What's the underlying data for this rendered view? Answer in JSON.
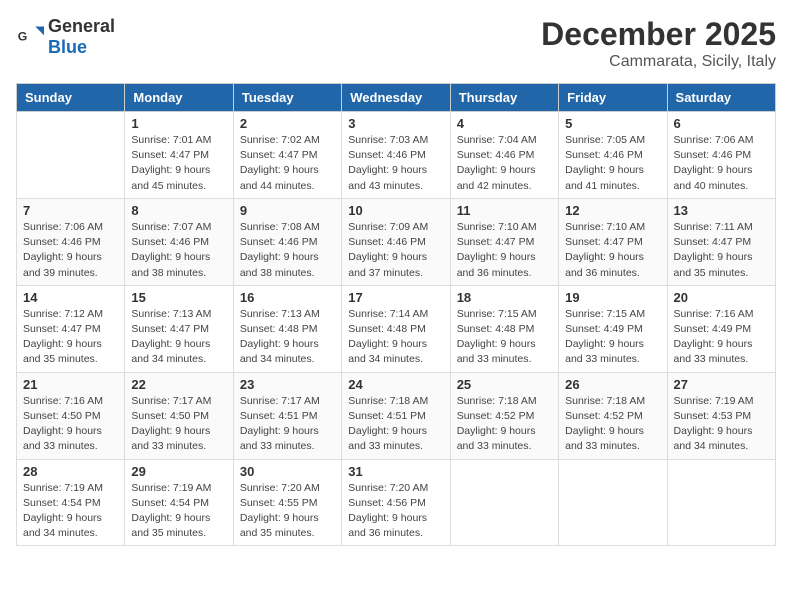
{
  "header": {
    "logo_general": "General",
    "logo_blue": "Blue",
    "month": "December 2025",
    "location": "Cammarata, Sicily, Italy"
  },
  "days_of_week": [
    "Sunday",
    "Monday",
    "Tuesday",
    "Wednesday",
    "Thursday",
    "Friday",
    "Saturday"
  ],
  "weeks": [
    [
      {
        "day": "",
        "sunrise": "",
        "sunset": "",
        "daylight": ""
      },
      {
        "day": "1",
        "sunrise": "Sunrise: 7:01 AM",
        "sunset": "Sunset: 4:47 PM",
        "daylight": "Daylight: 9 hours and 45 minutes."
      },
      {
        "day": "2",
        "sunrise": "Sunrise: 7:02 AM",
        "sunset": "Sunset: 4:47 PM",
        "daylight": "Daylight: 9 hours and 44 minutes."
      },
      {
        "day": "3",
        "sunrise": "Sunrise: 7:03 AM",
        "sunset": "Sunset: 4:46 PM",
        "daylight": "Daylight: 9 hours and 43 minutes."
      },
      {
        "day": "4",
        "sunrise": "Sunrise: 7:04 AM",
        "sunset": "Sunset: 4:46 PM",
        "daylight": "Daylight: 9 hours and 42 minutes."
      },
      {
        "day": "5",
        "sunrise": "Sunrise: 7:05 AM",
        "sunset": "Sunset: 4:46 PM",
        "daylight": "Daylight: 9 hours and 41 minutes."
      },
      {
        "day": "6",
        "sunrise": "Sunrise: 7:06 AM",
        "sunset": "Sunset: 4:46 PM",
        "daylight": "Daylight: 9 hours and 40 minutes."
      }
    ],
    [
      {
        "day": "7",
        "sunrise": "Sunrise: 7:06 AM",
        "sunset": "Sunset: 4:46 PM",
        "daylight": "Daylight: 9 hours and 39 minutes."
      },
      {
        "day": "8",
        "sunrise": "Sunrise: 7:07 AM",
        "sunset": "Sunset: 4:46 PM",
        "daylight": "Daylight: 9 hours and 38 minutes."
      },
      {
        "day": "9",
        "sunrise": "Sunrise: 7:08 AM",
        "sunset": "Sunset: 4:46 PM",
        "daylight": "Daylight: 9 hours and 38 minutes."
      },
      {
        "day": "10",
        "sunrise": "Sunrise: 7:09 AM",
        "sunset": "Sunset: 4:46 PM",
        "daylight": "Daylight: 9 hours and 37 minutes."
      },
      {
        "day": "11",
        "sunrise": "Sunrise: 7:10 AM",
        "sunset": "Sunset: 4:47 PM",
        "daylight": "Daylight: 9 hours and 36 minutes."
      },
      {
        "day": "12",
        "sunrise": "Sunrise: 7:10 AM",
        "sunset": "Sunset: 4:47 PM",
        "daylight": "Daylight: 9 hours and 36 minutes."
      },
      {
        "day": "13",
        "sunrise": "Sunrise: 7:11 AM",
        "sunset": "Sunset: 4:47 PM",
        "daylight": "Daylight: 9 hours and 35 minutes."
      }
    ],
    [
      {
        "day": "14",
        "sunrise": "Sunrise: 7:12 AM",
        "sunset": "Sunset: 4:47 PM",
        "daylight": "Daylight: 9 hours and 35 minutes."
      },
      {
        "day": "15",
        "sunrise": "Sunrise: 7:13 AM",
        "sunset": "Sunset: 4:47 PM",
        "daylight": "Daylight: 9 hours and 34 minutes."
      },
      {
        "day": "16",
        "sunrise": "Sunrise: 7:13 AM",
        "sunset": "Sunset: 4:48 PM",
        "daylight": "Daylight: 9 hours and 34 minutes."
      },
      {
        "day": "17",
        "sunrise": "Sunrise: 7:14 AM",
        "sunset": "Sunset: 4:48 PM",
        "daylight": "Daylight: 9 hours and 34 minutes."
      },
      {
        "day": "18",
        "sunrise": "Sunrise: 7:15 AM",
        "sunset": "Sunset: 4:48 PM",
        "daylight": "Daylight: 9 hours and 33 minutes."
      },
      {
        "day": "19",
        "sunrise": "Sunrise: 7:15 AM",
        "sunset": "Sunset: 4:49 PM",
        "daylight": "Daylight: 9 hours and 33 minutes."
      },
      {
        "day": "20",
        "sunrise": "Sunrise: 7:16 AM",
        "sunset": "Sunset: 4:49 PM",
        "daylight": "Daylight: 9 hours and 33 minutes."
      }
    ],
    [
      {
        "day": "21",
        "sunrise": "Sunrise: 7:16 AM",
        "sunset": "Sunset: 4:50 PM",
        "daylight": "Daylight: 9 hours and 33 minutes."
      },
      {
        "day": "22",
        "sunrise": "Sunrise: 7:17 AM",
        "sunset": "Sunset: 4:50 PM",
        "daylight": "Daylight: 9 hours and 33 minutes."
      },
      {
        "day": "23",
        "sunrise": "Sunrise: 7:17 AM",
        "sunset": "Sunset: 4:51 PM",
        "daylight": "Daylight: 9 hours and 33 minutes."
      },
      {
        "day": "24",
        "sunrise": "Sunrise: 7:18 AM",
        "sunset": "Sunset: 4:51 PM",
        "daylight": "Daylight: 9 hours and 33 minutes."
      },
      {
        "day": "25",
        "sunrise": "Sunrise: 7:18 AM",
        "sunset": "Sunset: 4:52 PM",
        "daylight": "Daylight: 9 hours and 33 minutes."
      },
      {
        "day": "26",
        "sunrise": "Sunrise: 7:18 AM",
        "sunset": "Sunset: 4:52 PM",
        "daylight": "Daylight: 9 hours and 33 minutes."
      },
      {
        "day": "27",
        "sunrise": "Sunrise: 7:19 AM",
        "sunset": "Sunset: 4:53 PM",
        "daylight": "Daylight: 9 hours and 34 minutes."
      }
    ],
    [
      {
        "day": "28",
        "sunrise": "Sunrise: 7:19 AM",
        "sunset": "Sunset: 4:54 PM",
        "daylight": "Daylight: 9 hours and 34 minutes."
      },
      {
        "day": "29",
        "sunrise": "Sunrise: 7:19 AM",
        "sunset": "Sunset: 4:54 PM",
        "daylight": "Daylight: 9 hours and 35 minutes."
      },
      {
        "day": "30",
        "sunrise": "Sunrise: 7:20 AM",
        "sunset": "Sunset: 4:55 PM",
        "daylight": "Daylight: 9 hours and 35 minutes."
      },
      {
        "day": "31",
        "sunrise": "Sunrise: 7:20 AM",
        "sunset": "Sunset: 4:56 PM",
        "daylight": "Daylight: 9 hours and 36 minutes."
      },
      {
        "day": "",
        "sunrise": "",
        "sunset": "",
        "daylight": ""
      },
      {
        "day": "",
        "sunrise": "",
        "sunset": "",
        "daylight": ""
      },
      {
        "day": "",
        "sunrise": "",
        "sunset": "",
        "daylight": ""
      }
    ]
  ]
}
